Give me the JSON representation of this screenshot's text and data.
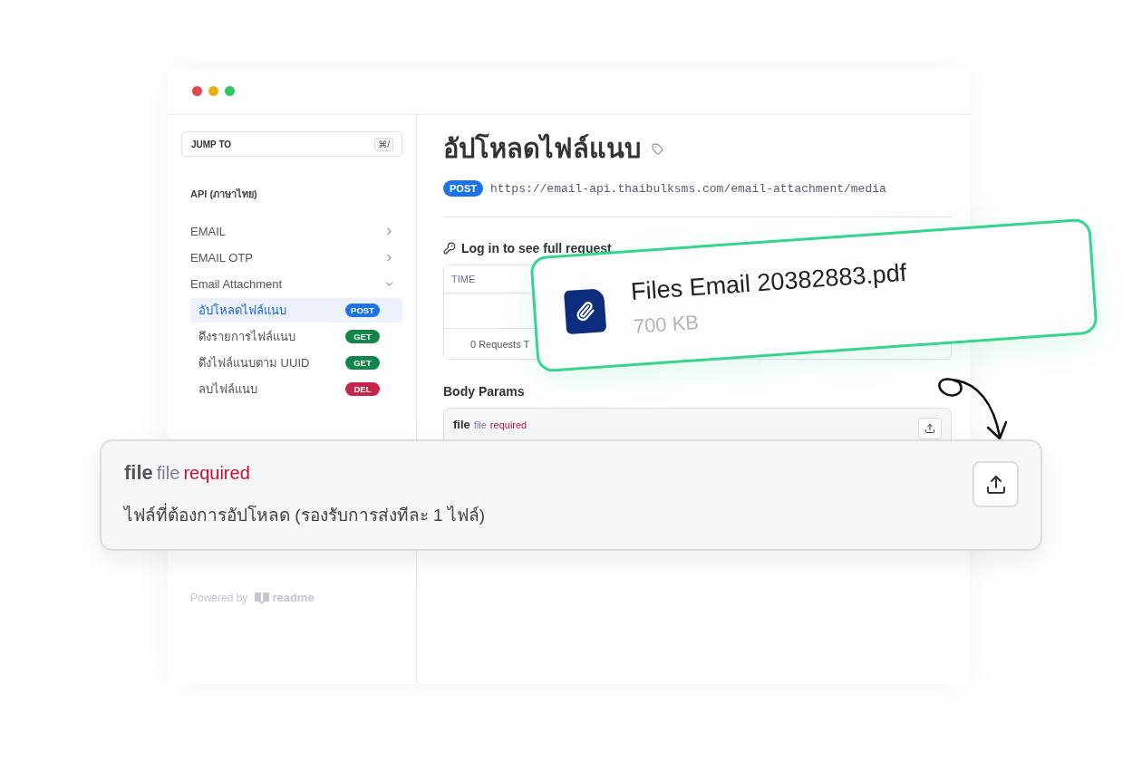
{
  "window": {
    "dots": [
      {
        "color": "#e5484d"
      },
      {
        "color": "#e5b00f"
      },
      {
        "color": "#30c85e"
      }
    ]
  },
  "sidebar": {
    "jump_to": {
      "label": "JUMP TO",
      "shortcut": "⌘/"
    },
    "section_title": "API (ภาษาไทย)",
    "items": [
      {
        "label": "EMAIL",
        "expanded": false
      },
      {
        "label": "EMAIL OTP",
        "expanded": false
      },
      {
        "label": "Email Attachment",
        "expanded": true,
        "children": [
          {
            "label": "อัปโหลดไฟล์แนบ",
            "method": "POST",
            "color": "#1a73e8",
            "selected": true
          },
          {
            "label": "ดึงรายการไฟล์แนบ",
            "method": "GET",
            "color": "#12864a",
            "selected": false
          },
          {
            "label": "ดึงไฟล์แนบตาม UUID",
            "method": "GET",
            "color": "#12864a",
            "selected": false
          },
          {
            "label": "ลบไฟล์แนบ",
            "method": "DEL",
            "color": "#c9254a",
            "selected": false
          }
        ]
      }
    ],
    "footer": {
      "powered_by": "Powered by",
      "brand": "readme"
    }
  },
  "main": {
    "title": "อัปโหลดไฟล์แนบ",
    "method": "POST",
    "url": "https://email-api.thaibulksms.com/email-attachment/media",
    "history": {
      "title": "Log in to see full request",
      "columns": [
        "TIME"
      ],
      "footer": "0 Requests T"
    },
    "body_params": {
      "title": "Body Params",
      "param": {
        "name": "file",
        "type": "file",
        "required": "required"
      }
    }
  },
  "file_card": {
    "name": "Files Email 20382883.pdf",
    "size": "700 KB"
  },
  "param_card": {
    "name": "file",
    "type": "file",
    "required": "required",
    "description": "ไฟล์ที่ต้องการอัปโหลด (รองรับการส่งทีละ 1 ไฟล์)"
  }
}
